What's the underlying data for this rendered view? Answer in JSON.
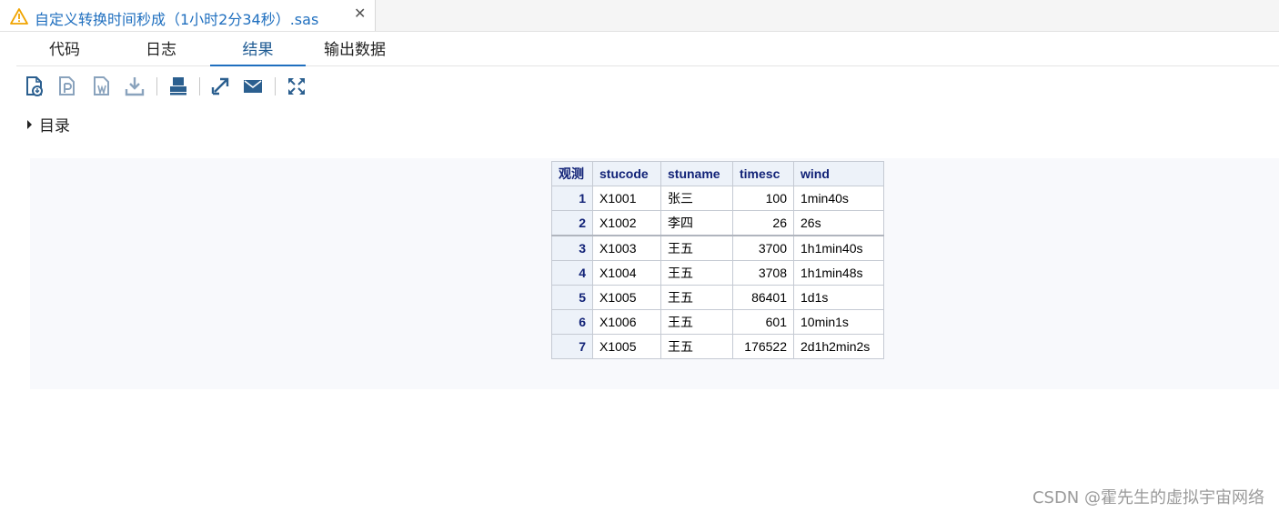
{
  "file_tab": {
    "title": "自定义转换时间秒成（1小时2分34秒）.sas",
    "close_glyph": "✕",
    "warning_color": "#f0a400"
  },
  "subtabs": [
    "代码",
    "日志",
    "结果",
    "输出数据"
  ],
  "active_subtab": "结果",
  "toolbar": {
    "icons": [
      "html-download-icon",
      "pdf-download-icon",
      "word-download-icon",
      "download-icon",
      "print-icon",
      "open-new-window-icon",
      "email-icon",
      "fullscreen-icon"
    ]
  },
  "toc": {
    "label": "目录"
  },
  "table": {
    "headers": [
      "观测",
      "stucode",
      "stuname",
      "timesc",
      "wind"
    ],
    "rows": [
      [
        "1",
        "X1001",
        "张三",
        "100",
        "1min40s"
      ],
      [
        "2",
        "X1002",
        "李四",
        "26",
        "26s"
      ],
      [
        "3",
        "X1003",
        "王五",
        "3700",
        "1h1min40s"
      ],
      [
        "4",
        "X1004",
        "王五",
        "3708",
        "1h1min48s"
      ],
      [
        "5",
        "X1005",
        "王五",
        "86401",
        "1d1s"
      ],
      [
        "6",
        "X1006",
        "王五",
        "601",
        "10min1s"
      ],
      [
        "7",
        "X1005",
        "王五",
        "176522",
        "2d1h2min2s"
      ]
    ]
  },
  "watermark": "CSDN @霍先生的虚拟宇宙网络",
  "colors": {
    "accent": "#1f6fbf",
    "header_text": "#112277",
    "header_bg": "#edf2f9",
    "toolbar_icon": "#2b5f8f"
  }
}
